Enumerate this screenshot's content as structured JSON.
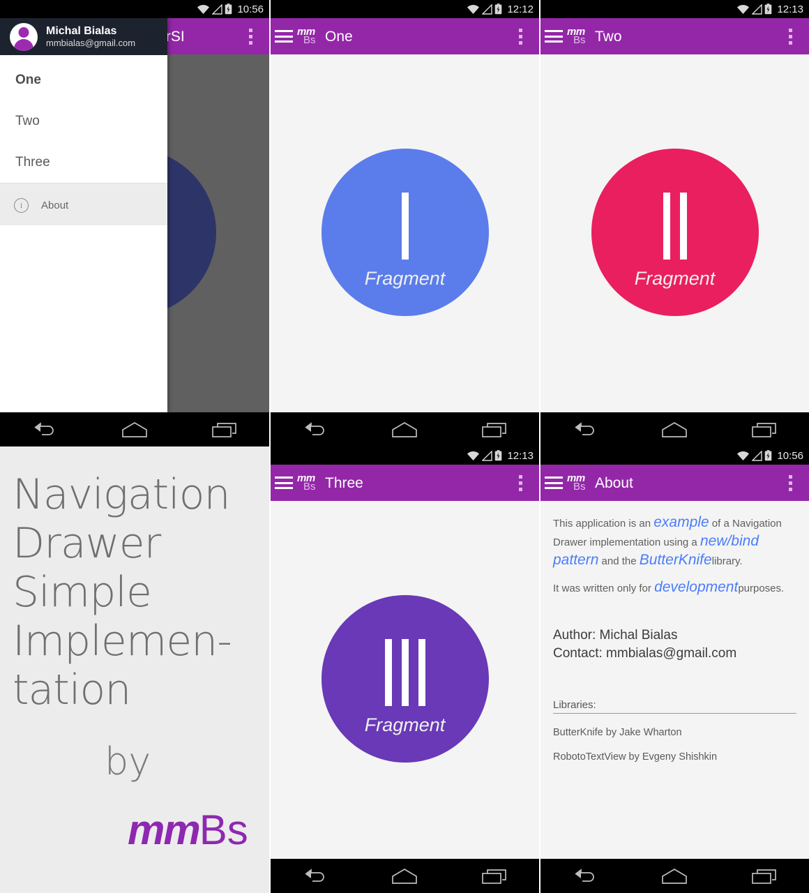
{
  "app": {
    "logo_top": "mm",
    "logo_bottom": "Bs",
    "splash_logo_mm": "mm",
    "splash_logo_bs": "Bs"
  },
  "panels": {
    "drawer": {
      "status_time": "10:56",
      "toolbar_title": "NavigationDrawerSI",
      "user_name": "Michal Bialas",
      "user_email": "mmbialas@gmail.com",
      "items": [
        {
          "label": "One",
          "selected": true
        },
        {
          "label": "Two",
          "selected": false
        },
        {
          "label": "Three",
          "selected": false
        }
      ],
      "about_label": "About",
      "about_icon": "info-circle-icon",
      "scrim_fragment_label": "t"
    },
    "one": {
      "status_time": "12:12",
      "toolbar_title": "One",
      "circle_color": "#5b7ceb",
      "roman": 1,
      "fragment_label": "Fragment"
    },
    "two": {
      "status_time": "12:13",
      "toolbar_title": "Two",
      "circle_color": "#ea1f5f",
      "roman": 2,
      "fragment_label": "Fragment"
    },
    "three": {
      "status_time": "12:13",
      "toolbar_title": "Three",
      "circle_color": "#6939b7",
      "roman": 3,
      "fragment_label": "Fragment"
    },
    "splash": {
      "title": "Navigation Drawer Simple Implemen-tation",
      "title_lines": [
        "Navigation",
        "Drawer",
        "Simple",
        "Implemen-",
        "tation"
      ],
      "by": "by"
    },
    "about": {
      "status_time": "10:56",
      "toolbar_title": "About",
      "paragraph1": {
        "t1": "This application is an ",
        "h1": "example",
        "t2": " of a Navigation Drawer implementation using a ",
        "h2": "new/bind pattern",
        "t3": " and the ",
        "h3": "ButterKnife",
        "t4": "library."
      },
      "paragraph2": {
        "t1": "It was written only for ",
        "h1": "development",
        "t2": "purposes."
      },
      "author": "Author: Michal Bialas",
      "contact": "Contact: mmbialas@gmail.com",
      "libraries_heading": "Libraries:",
      "libraries": [
        "ButterKnife by Jake Wharton",
        "RobotoTextView by Evgeny Shishkin"
      ],
      "highlight_color": "#4a7dfb"
    }
  },
  "statusbar": {
    "wifi_icon": "wifi-icon",
    "signal_icon": "signal-triangle-icon",
    "battery_icon": "battery-charging-icon"
  },
  "navbar": {
    "back": "back-icon",
    "home": "home-icon",
    "recents": "recents-icon"
  },
  "toolbar": {
    "menu_icon": "hamburger-menu-icon",
    "overflow_icon": "overflow-menu-icon",
    "color": "#9327a8"
  }
}
